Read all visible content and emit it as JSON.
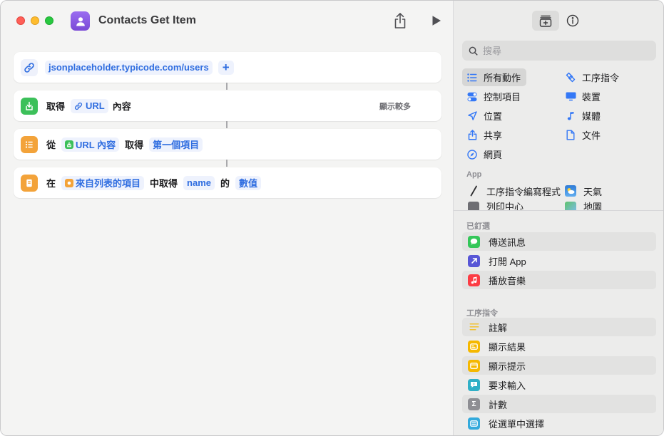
{
  "window": {
    "title": "Contacts Get Item"
  },
  "actions": {
    "url": {
      "value": "jsonplaceholder.typicode.com/users",
      "add": "+"
    },
    "get_contents": {
      "verb": "取得",
      "token": "URL",
      "suffix": "內容",
      "show_more": "顯示較多"
    },
    "get_item": {
      "from": "從",
      "token": "URL 內容",
      "verb": "取得",
      "item": "第一個項目"
    },
    "get_value": {
      "in": "在",
      "token": "來自列表的項目",
      "verb": "中取得",
      "key": "name",
      "of": "的",
      "value": "數值"
    }
  },
  "library": {
    "search_placeholder": "搜尋",
    "categories": [
      {
        "label": "所有動作",
        "icon": "list-icon"
      },
      {
        "label": "工序指令",
        "icon": "shortcuts-icon"
      },
      {
        "label": "控制項目",
        "icon": "toggle-icon"
      },
      {
        "label": "裝置",
        "icon": "display-icon"
      },
      {
        "label": "位置",
        "icon": "location-icon"
      },
      {
        "label": "媒體",
        "icon": "music-note-icon"
      },
      {
        "label": "共享",
        "icon": "share-icon"
      },
      {
        "label": "文件",
        "icon": "document-icon"
      },
      {
        "label": "網頁",
        "icon": "compass-icon"
      }
    ],
    "app_section": "App",
    "apps": [
      {
        "label": "工序指令編寫程式",
        "icon": "script-editor-icon"
      },
      {
        "label": "天氣",
        "icon": "weather-icon"
      },
      {
        "label": "列印中心",
        "icon": "printer-icon"
      },
      {
        "label": "地圖",
        "icon": "maps-icon"
      }
    ],
    "pinned_section": "已釘選",
    "pinned": [
      {
        "label": "傳送訊息",
        "icon": "messages-icon",
        "color": "#34c759"
      },
      {
        "label": "打開 App",
        "icon": "open-app-icon",
        "color": "#5856d6"
      },
      {
        "label": "播放音樂",
        "icon": "music-icon",
        "color": "#fc3c44"
      }
    ],
    "scripting_section": "工序指令",
    "scripting": [
      {
        "label": "註解",
        "icon": "comment-icon",
        "color": "#f7d154"
      },
      {
        "label": "顯示結果",
        "icon": "show-result-icon",
        "color": "#f5b800"
      },
      {
        "label": "顯示提示",
        "icon": "show-alert-icon",
        "color": "#f5b800"
      },
      {
        "label": "要求輸入",
        "icon": "ask-input-icon",
        "color": "#30b0c7"
      },
      {
        "label": "計數",
        "icon": "sigma-icon",
        "color": "#8e8e93"
      },
      {
        "label": "從選單中選擇",
        "icon": "menu-choose-icon",
        "color": "#34aadc"
      }
    ]
  }
}
